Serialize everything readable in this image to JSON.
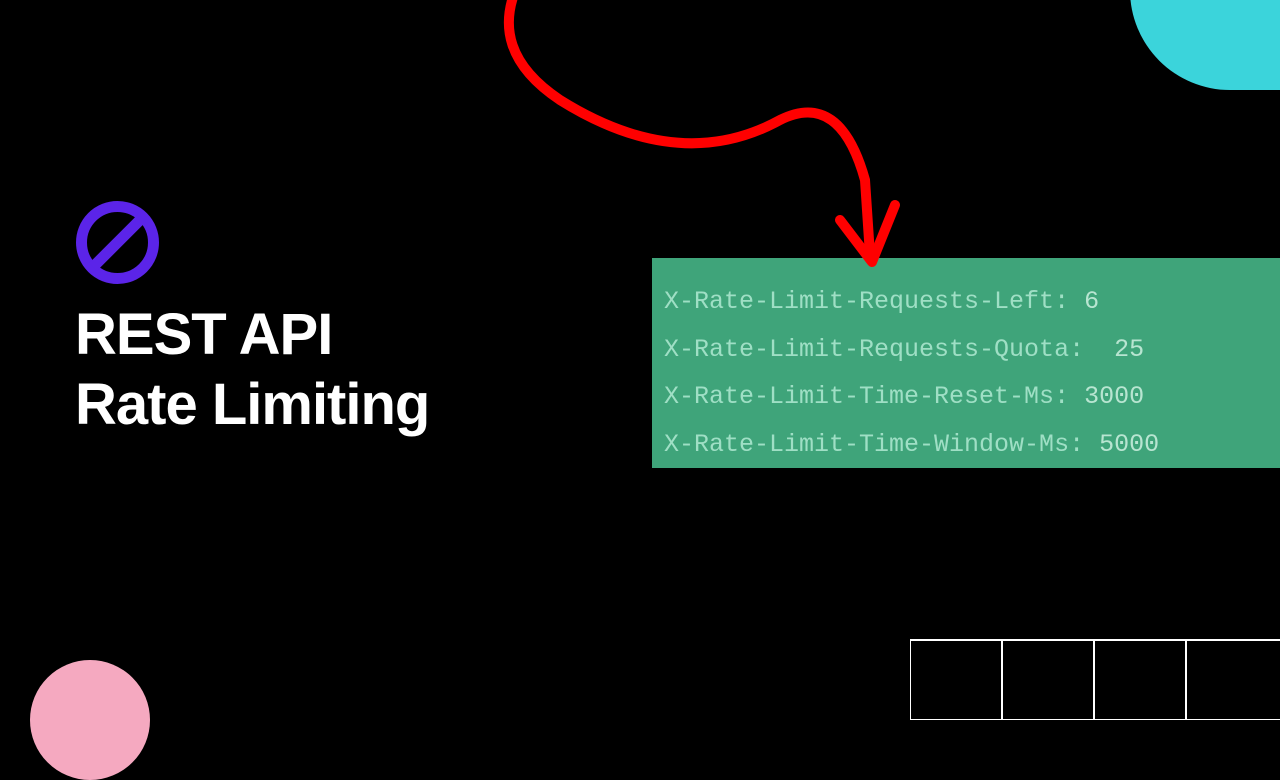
{
  "title_line1": "REST API",
  "title_line2": "Rate Limiting",
  "headers": [
    {
      "name": "X-Rate-Limit-Requests-Left:",
      "value": "6"
    },
    {
      "name": "X-Rate-Limit-Requests-Quota:",
      "value": "25"
    },
    {
      "name": "X-Rate-Limit-Time-Reset-Ms:",
      "value": "3000"
    },
    {
      "name": "X-Rate-Limit-Time-Window-Ms:",
      "value": "5000"
    }
  ],
  "colors": {
    "cyan": "#3BD4DB",
    "pink": "#F5A9C0",
    "purple": "#5B24E8",
    "red": "#FF0000",
    "green_box": "#3FA47A"
  }
}
